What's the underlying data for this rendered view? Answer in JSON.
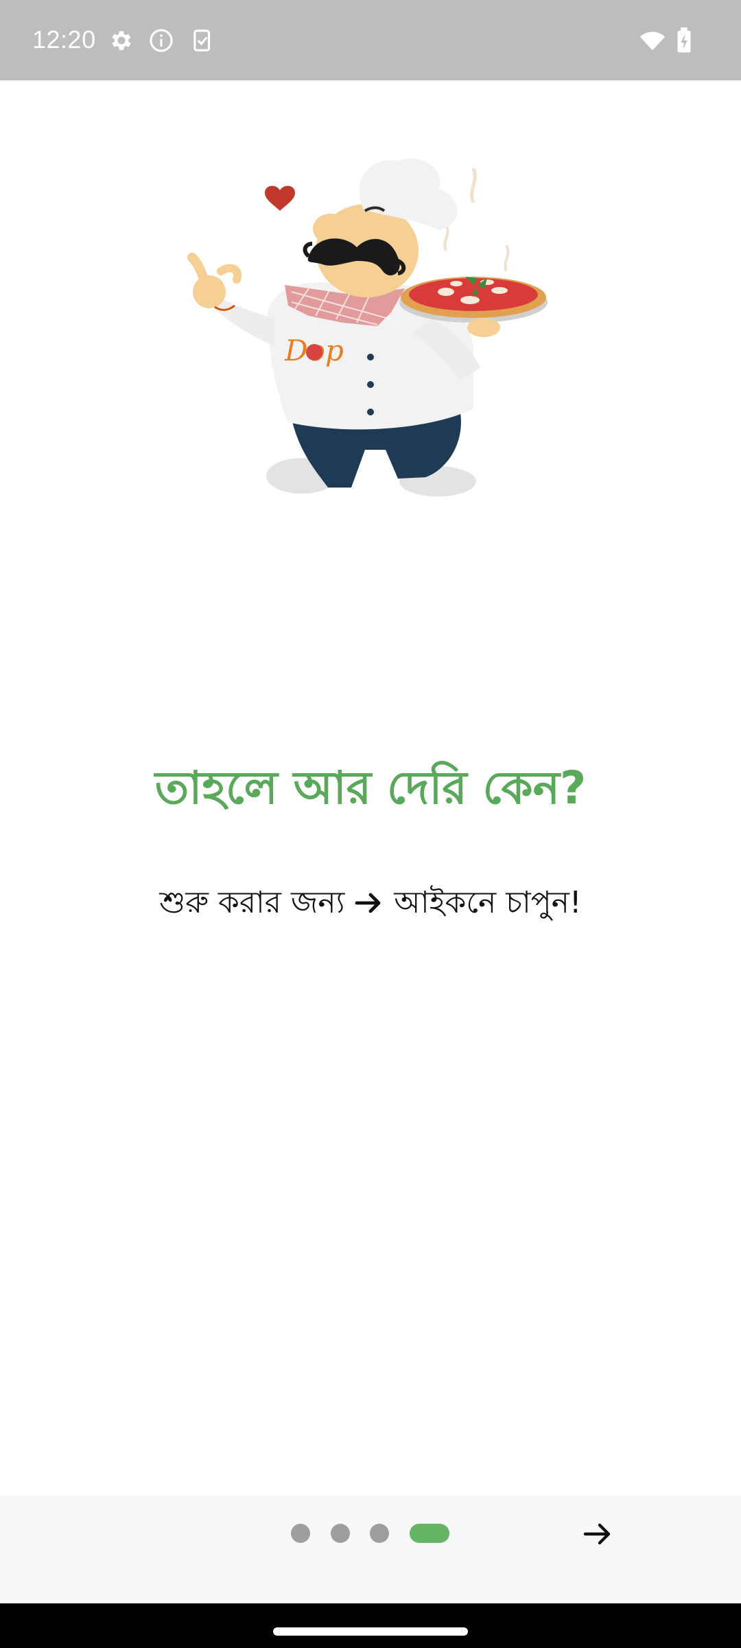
{
  "status_bar": {
    "time": "12:20",
    "icons": [
      "gear-icon",
      "info-icon",
      "clipboard-check-icon",
      "wifi-icon",
      "battery-charging-icon"
    ],
    "background": "#bdbdbd"
  },
  "onboarding": {
    "illustration": {
      "logo_text": "Dop",
      "subject": "chef-holding-pizza"
    },
    "headline": "তাহলে আর দেরি কেন?",
    "subline_before": "শুরু করার জন্য",
    "subline_icon": "arrow-right-icon",
    "subline_after": "আইকনে চাপুন!",
    "headline_color": "#5aa85a"
  },
  "pager": {
    "total_pages": 4,
    "current_page": 4,
    "next_icon": "arrow-right-icon",
    "active_color": "#66b566",
    "inactive_color": "#9e9e9e"
  }
}
